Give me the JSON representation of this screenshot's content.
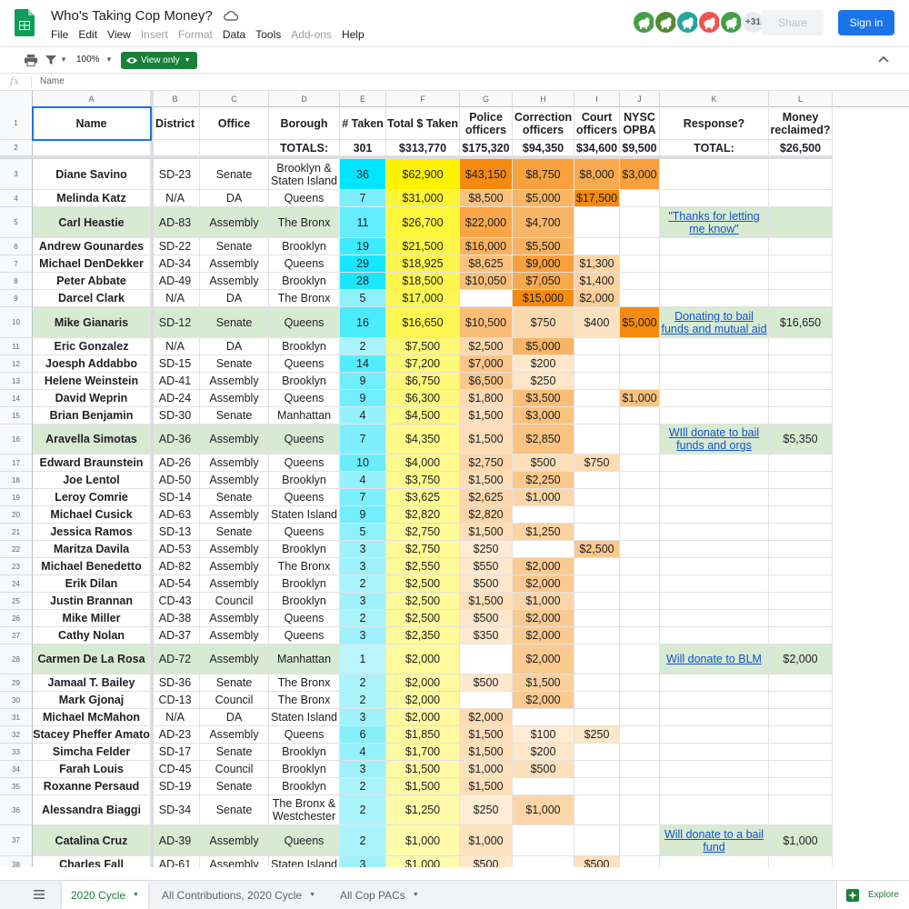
{
  "app": {
    "title": "Who's Taking Cop Money?",
    "menu": [
      {
        "label": "File",
        "enabled": true
      },
      {
        "label": "Edit",
        "enabled": true
      },
      {
        "label": "View",
        "enabled": true
      },
      {
        "label": "Insert",
        "enabled": false
      },
      {
        "label": "Format",
        "enabled": false
      },
      {
        "label": "Data",
        "enabled": true
      },
      {
        "label": "Tools",
        "enabled": true
      },
      {
        "label": "Add-ons",
        "enabled": false
      },
      {
        "label": "Help",
        "enabled": true
      }
    ],
    "avatars": [
      {
        "icon": "elephant-icon",
        "color": "#43a047"
      },
      {
        "icon": "deer-icon",
        "color": "#558b2f"
      },
      {
        "icon": "dolphin-icon",
        "color": "#26a69a"
      },
      {
        "icon": "bat-icon",
        "color": "#ef5350"
      },
      {
        "icon": "horse-icon",
        "color": "#43a047"
      }
    ],
    "avatars_more": "+31",
    "share_label": "Share",
    "signin_label": "Sign in"
  },
  "toolbar": {
    "zoom": "100%",
    "view_only_label": "View only"
  },
  "formula_bar": {
    "fx": "fx",
    "content": "Name"
  },
  "columns": [
    "A",
    "B",
    "C",
    "D",
    "E",
    "F",
    "G",
    "H",
    "I",
    "J",
    "K",
    "L"
  ],
  "header": {
    "row1": [
      "Name",
      "District",
      "Office",
      "Borough",
      "# Taken",
      "Total $ Taken",
      "Police officers",
      "Correction officers",
      "Court officers",
      "NYSC OPBA",
      "Response?",
      "Money reclaimed?"
    ],
    "row2": [
      "",
      "",
      "",
      "TOTALS:",
      "301",
      "$313,770",
      "$175,320",
      "$94,350",
      "$34,600",
      "$9,500",
      "TOTAL:",
      "$26,500"
    ]
  },
  "rows": [
    {
      "num": "3",
      "cells": [
        "Diane Savino",
        "SD-23",
        "Senate",
        "Brooklyn & Staten Island",
        "36",
        "$62,900",
        "$43,150",
        "$8,750",
        "$8,000",
        "$3,000",
        "",
        ""
      ]
    },
    {
      "num": "4",
      "cells": [
        "Melinda Katz",
        "N/A",
        "DA",
        "Queens",
        "7",
        "$31,000",
        "$8,500",
        "$5,000",
        "$17,500",
        "",
        "",
        ""
      ]
    },
    {
      "num": "5",
      "cells": [
        "Carl Heastie",
        "AD-83",
        "Assembly",
        "The Bronx",
        "11",
        "$26,700",
        "$22,000",
        "$4,700",
        "",
        "",
        "\"Thanks for letting me know\"",
        ""
      ]
    },
    {
      "num": "6",
      "cells": [
        "Andrew Gounardes",
        "SD-22",
        "Senate",
        "Brooklyn",
        "19",
        "$21,500",
        "$16,000",
        "$5,500",
        "",
        "",
        "",
        ""
      ]
    },
    {
      "num": "7",
      "cells": [
        "Michael DenDekker",
        "AD-34",
        "Assembly",
        "Queens",
        "29",
        "$18,925",
        "$8,625",
        "$9,000",
        "$1,300",
        "",
        "",
        ""
      ]
    },
    {
      "num": "8",
      "cells": [
        "Peter Abbate",
        "AD-49",
        "Assembly",
        "Brooklyn",
        "28",
        "$18,500",
        "$10,050",
        "$7,050",
        "$1,400",
        "",
        "",
        ""
      ]
    },
    {
      "num": "9",
      "cells": [
        "Darcel Clark",
        "N/A",
        "DA",
        "The Bronx",
        "5",
        "$17,000",
        "",
        "$15,000",
        "$2,000",
        "",
        "",
        ""
      ]
    },
    {
      "num": "10",
      "cells": [
        "Mike Gianaris",
        "SD-12",
        "Senate",
        "Queens",
        "16",
        "$16,650",
        "$10,500",
        "$750",
        "$400",
        "$5,000",
        "Donating to bail funds and mutual aid",
        "$16,650"
      ]
    },
    {
      "num": "11",
      "cells": [
        "Eric Gonzalez",
        "N/A",
        "DA",
        "Brooklyn",
        "2",
        "$7,500",
        "$2,500",
        "$5,000",
        "",
        "",
        "",
        ""
      ]
    },
    {
      "num": "12",
      "cells": [
        "Joesph Addabbo",
        "SD-15",
        "Senate",
        "Queens",
        "14",
        "$7,200",
        "$7,000",
        "$200",
        "",
        "",
        "",
        ""
      ]
    },
    {
      "num": "13",
      "cells": [
        "Helene Weinstein",
        "AD-41",
        "Assembly",
        "Brooklyn",
        "9",
        "$6,750",
        "$6,500",
        "$250",
        "",
        "",
        "",
        ""
      ]
    },
    {
      "num": "14",
      "cells": [
        "David Weprin",
        "AD-24",
        "Assembly",
        "Queens",
        "9",
        "$6,300",
        "$1,800",
        "$3,500",
        "",
        "$1,000",
        "",
        ""
      ]
    },
    {
      "num": "15",
      "cells": [
        "Brian Benjamin",
        "SD-30",
        "Senate",
        "Manhattan",
        "4",
        "$4,500",
        "$1,500",
        "$3,000",
        "",
        "",
        "",
        ""
      ]
    },
    {
      "num": "16",
      "cells": [
        "Aravella Simotas",
        "AD-36",
        "Assembly",
        "Queens",
        "7",
        "$4,350",
        "$1,500",
        "$2,850",
        "",
        "",
        "WIll donate to bail funds and orgs",
        "$5,350"
      ]
    },
    {
      "num": "17",
      "cells": [
        "Edward Braunstein",
        "AD-26",
        "Assembly",
        "Queens",
        "10",
        "$4,000",
        "$2,750",
        "$500",
        "$750",
        "",
        "",
        ""
      ]
    },
    {
      "num": "18",
      "cells": [
        "Joe Lentol",
        "AD-50",
        "Assembly",
        "Brooklyn",
        "4",
        "$3,750",
        "$1,500",
        "$2,250",
        "",
        "",
        "",
        ""
      ]
    },
    {
      "num": "19",
      "cells": [
        "Leroy Comrie",
        "SD-14",
        "Senate",
        "Queens",
        "7",
        "$3,625",
        "$2,625",
        "$1,000",
        "",
        "",
        "",
        ""
      ]
    },
    {
      "num": "20",
      "cells": [
        "Michael Cusick",
        "AD-63",
        "Assembly",
        "Staten Island",
        "9",
        "$2,820",
        "$2,820",
        "",
        "",
        "",
        "",
        ""
      ]
    },
    {
      "num": "21",
      "cells": [
        "Jessica Ramos",
        "SD-13",
        "Senate",
        "Queens",
        "5",
        "$2,750",
        "$1,500",
        "$1,250",
        "",
        "",
        "",
        ""
      ]
    },
    {
      "num": "22",
      "cells": [
        "Maritza Davila",
        "AD-53",
        "Assembly",
        "Brooklyn",
        "3",
        "$2,750",
        "$250",
        "",
        "$2,500",
        "",
        "",
        ""
      ]
    },
    {
      "num": "23",
      "cells": [
        "Michael Benedetto",
        "AD-82",
        "Assembly",
        "The Bronx",
        "3",
        "$2,550",
        "$550",
        "$2,000",
        "",
        "",
        "",
        ""
      ]
    },
    {
      "num": "24",
      "cells": [
        "Erik Dilan",
        "AD-54",
        "Assembly",
        "Brooklyn",
        "2",
        "$2,500",
        "$500",
        "$2,000",
        "",
        "",
        "",
        ""
      ]
    },
    {
      "num": "25",
      "cells": [
        "Justin Brannan",
        "CD-43",
        "Council",
        "Brooklyn",
        "3",
        "$2,500",
        "$1,500",
        "$1,000",
        "",
        "",
        "",
        ""
      ]
    },
    {
      "num": "26",
      "cells": [
        "Mike Miller",
        "AD-38",
        "Assembly",
        "Queens",
        "2",
        "$2,500",
        "$500",
        "$2,000",
        "",
        "",
        "",
        ""
      ]
    },
    {
      "num": "27",
      "cells": [
        "Cathy Nolan",
        "AD-37",
        "Assembly",
        "Queens",
        "3",
        "$2,350",
        "$350",
        "$2,000",
        "",
        "",
        "",
        ""
      ]
    },
    {
      "num": "28",
      "cells": [
        "Carmen De La Rosa",
        "AD-72",
        "Assembly",
        "Manhattan",
        "1",
        "$2,000",
        "",
        "$2,000",
        "",
        "",
        "Will donate to BLM",
        "$2,000"
      ]
    },
    {
      "num": "29",
      "cells": [
        "Jamaal T. Bailey",
        "SD-36",
        "Senate",
        "The Bronx",
        "2",
        "$2,000",
        "$500",
        "$1,500",
        "",
        "",
        "",
        ""
      ]
    },
    {
      "num": "30",
      "cells": [
        "Mark Gjonaj",
        "CD-13",
        "Council",
        "The Bronx",
        "2",
        "$2,000",
        "",
        "$2,000",
        "",
        "",
        "",
        ""
      ]
    },
    {
      "num": "31",
      "cells": [
        "Michael McMahon",
        "N/A",
        "DA",
        "Staten Island",
        "3",
        "$2,000",
        "$2,000",
        "",
        "",
        "",
        "",
        ""
      ]
    },
    {
      "num": "32",
      "cells": [
        "Stacey Pheffer Amato",
        "AD-23",
        "Assembly",
        "Queens",
        "6",
        "$1,850",
        "$1,500",
        "$100",
        "$250",
        "",
        "",
        ""
      ]
    },
    {
      "num": "33",
      "cells": [
        "Simcha Felder",
        "SD-17",
        "Senate",
        "Brooklyn",
        "4",
        "$1,700",
        "$1,500",
        "$200",
        "",
        "",
        "",
        ""
      ]
    },
    {
      "num": "34",
      "cells": [
        "Farah Louis",
        "CD-45",
        "Council",
        "Brooklyn",
        "3",
        "$1,500",
        "$1,000",
        "$500",
        "",
        "",
        "",
        ""
      ]
    },
    {
      "num": "35",
      "cells": [
        "Roxanne Persaud",
        "SD-19",
        "Senate",
        "Brooklyn",
        "2",
        "$1,500",
        "$1,500",
        "",
        "",
        "",
        "",
        ""
      ]
    },
    {
      "num": "36",
      "cells": [
        "Alessandra Biaggi",
        "SD-34",
        "Senate",
        "The Bronx & Westchester",
        "2",
        "$1,250",
        "$250",
        "$1,000",
        "",
        "",
        "",
        ""
      ]
    },
    {
      "num": "37",
      "cells": [
        "Catalina Cruz",
        "AD-39",
        "Assembly",
        "Queens",
        "2",
        "$1,000",
        "$1,000",
        "",
        "",
        "",
        "Will donate to a bail fund",
        "$1,000"
      ]
    },
    {
      "num": "38",
      "cells": [
        "Charles Fall",
        "AD-61",
        "Assembly",
        "Staten Island",
        "3",
        "$1,000",
        "$500",
        "",
        "$500",
        "",
        "",
        ""
      ]
    }
  ],
  "sheets": [
    {
      "label": "2020 Cycle",
      "active": true
    },
    {
      "label": "All Contributions, 2020 Cycle",
      "active": false
    },
    {
      "label": "All Cop PACs",
      "active": false
    }
  ],
  "explore_label": "Explore"
}
